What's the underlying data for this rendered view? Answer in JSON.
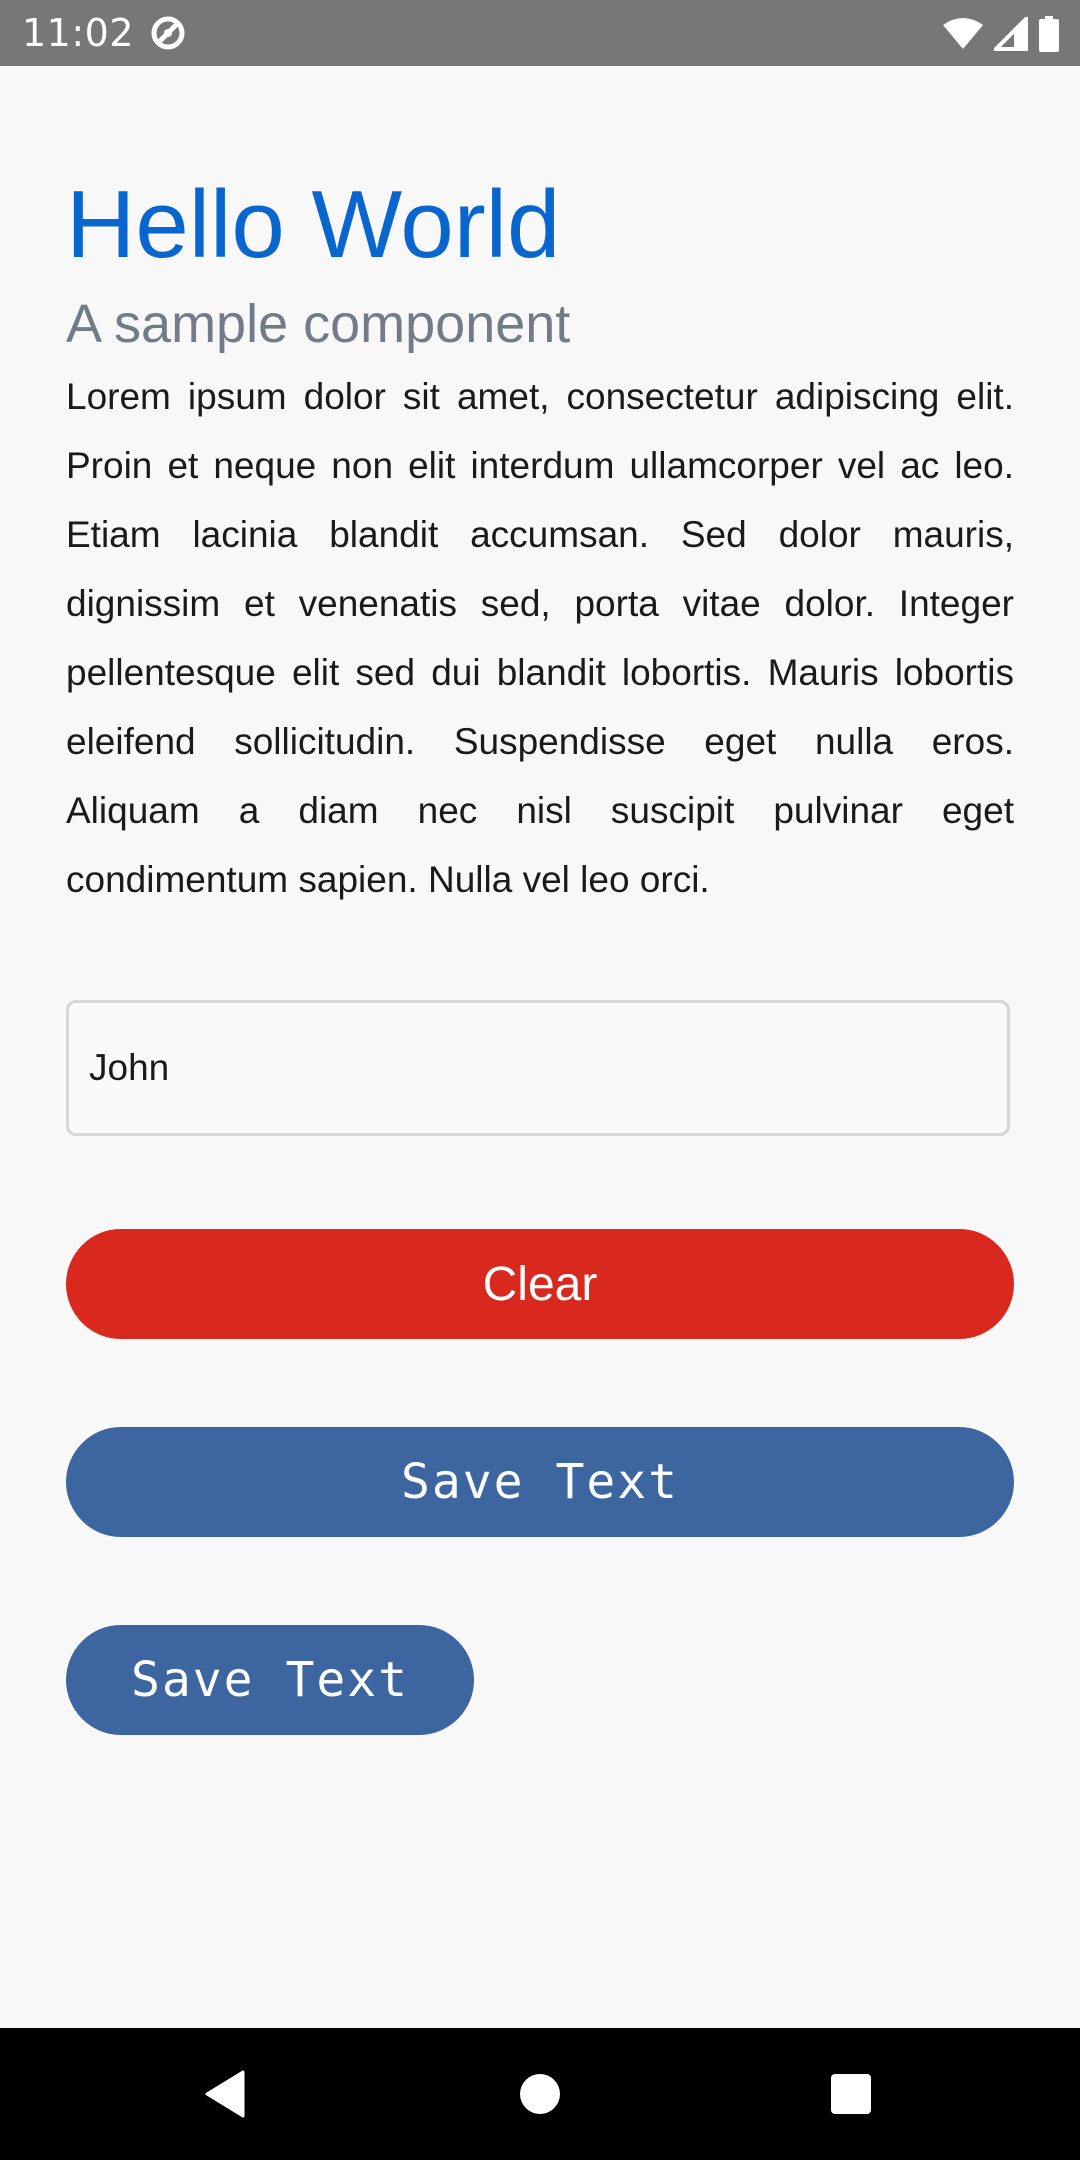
{
  "status_bar": {
    "time": "11:02",
    "icons": [
      "app-notification-icon",
      "wifi-icon",
      "cellular-signal-icon",
      "battery-icon"
    ]
  },
  "header": {
    "title": "Hello World",
    "subtitle": "A sample component"
  },
  "body": {
    "paragraph": "Lorem ipsum dolor sit amet, consectetur adipiscing elit. Proin et neque non elit interdum ullamcorper vel ac leo. Etiam lacinia blandit accumsan. Sed dolor mauris, dignissim et venenatis sed, porta vitae dolor. Integer pellentesque elit sed dui blandit lobortis. Mauris lobortis eleifend sollicitudin. Suspendisse eget nulla eros. Aliquam a diam nec nisl suscipit pulvinar eget condimentum sapien. Nulla vel leo orci."
  },
  "form": {
    "name_value": "John"
  },
  "buttons": {
    "clear_label": "Clear",
    "save_wide_label": "Save Text",
    "save_narrow_label": "Save Text"
  },
  "nav_bar": {
    "icons": [
      "back-icon",
      "home-icon",
      "recents-icon"
    ]
  },
  "colors": {
    "title": "#0a66cf",
    "subtitle": "#727b88",
    "clear_button": "#d9291f",
    "save_button": "#3d66a0",
    "status_bar": "#777777",
    "background": "#f8f8f8"
  }
}
